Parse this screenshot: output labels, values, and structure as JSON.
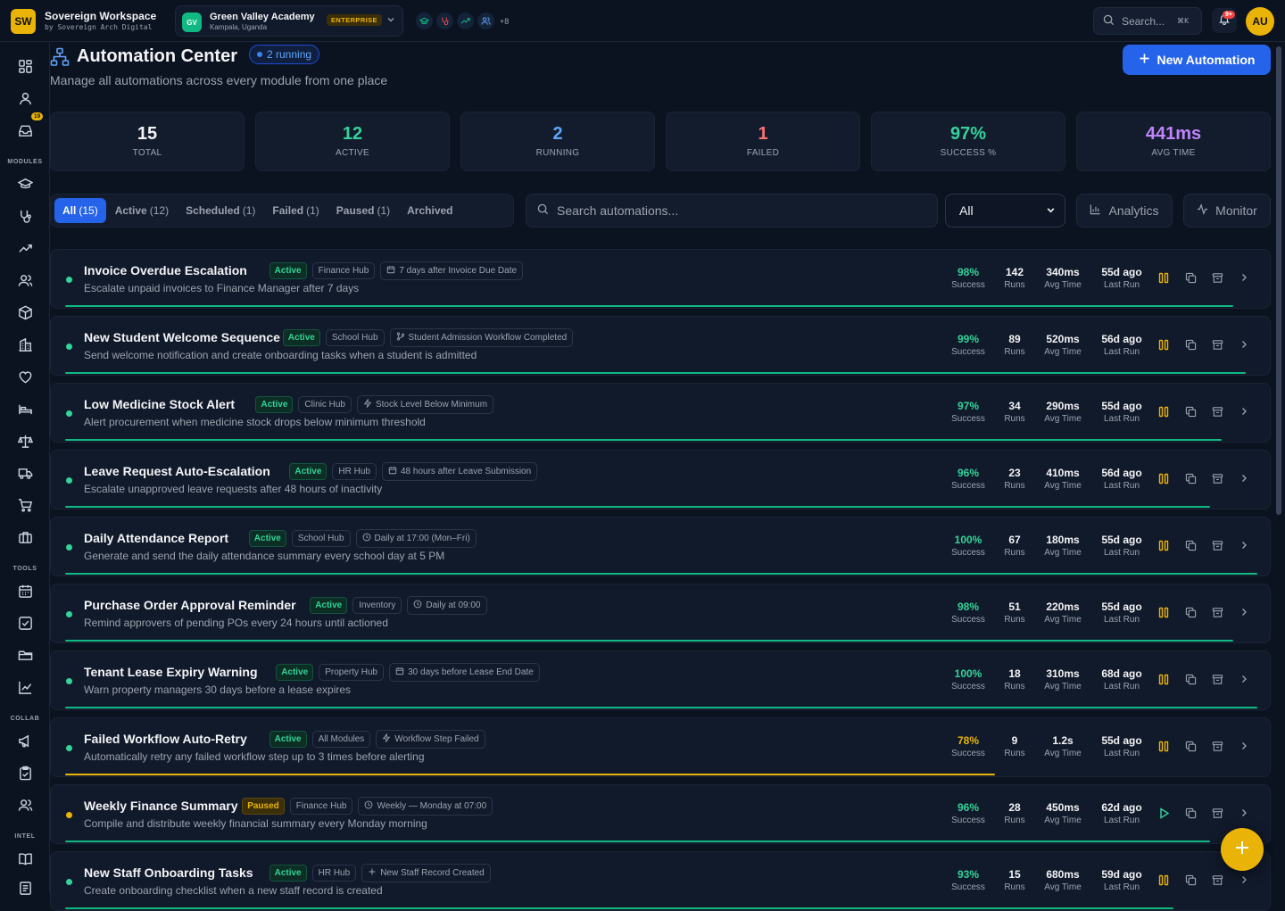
{
  "topbar": {
    "logo": "SW",
    "brand_title": "Sovereign Workspace",
    "brand_sub": "by Sovereign Arch Digital",
    "org_initials": "GV",
    "org_name": "Green Valley Academy",
    "org_location": "Kampala, Uganda",
    "org_badge": "ENTERPRISE",
    "modules_more": "+8",
    "search_label": "Search...",
    "search_kbd": "⌘K",
    "notif_count": "9+",
    "avatar": "AU"
  },
  "sidebar": {
    "badge": "19",
    "sections": [
      "MODULES",
      "TOOLS",
      "COLLAB",
      "INTEL"
    ]
  },
  "header": {
    "title": "Automation Center",
    "running": "2 running",
    "subtitle": "Manage all automations across every module from one place",
    "new_button": "New Automation"
  },
  "stats": [
    {
      "value": "15",
      "label": "TOTAL",
      "color": "#f3f4f6"
    },
    {
      "value": "12",
      "label": "ACTIVE",
      "color": "#34d399"
    },
    {
      "value": "2",
      "label": "RUNNING",
      "color": "#60a5fa"
    },
    {
      "value": "1",
      "label": "FAILED",
      "color": "#f87171"
    },
    {
      "value": "97%",
      "label": "SUCCESS %",
      "color": "#34d399"
    },
    {
      "value": "441ms",
      "label": "AVG TIME",
      "color": "#c084fc"
    }
  ],
  "tabs": [
    {
      "label": "All",
      "count": "(15)"
    },
    {
      "label": "Active",
      "count": "(12)"
    },
    {
      "label": "Scheduled",
      "count": "(1)"
    },
    {
      "label": "Failed",
      "count": "(1)"
    },
    {
      "label": "Paused",
      "count": "(1)"
    },
    {
      "label": "Archived",
      "count": ""
    }
  ],
  "toolbar": {
    "search_placeholder": "Search automations...",
    "filter_value": "All",
    "analytics": "Analytics",
    "monitor": "Monitor"
  },
  "metric_labels": {
    "success": "Success",
    "runs": "Runs",
    "avg": "Avg Time",
    "last": "Last Run"
  },
  "automations": [
    {
      "name": "Invoice Overdue Escalation",
      "status": "Active",
      "hub": "Finance Hub",
      "trigger": "7 days after Invoice Due Date",
      "trigger_icon": "calendar",
      "desc": "Escalate unpaid invoices to Finance Manager after 7 days",
      "success": "98%",
      "runs": "142",
      "avg": "340ms",
      "last": "55d ago",
      "progress": 0.98
    },
    {
      "name": "New Student Welcome Sequence",
      "status": "Active",
      "hub": "School Hub",
      "trigger": "Student Admission Workflow Completed",
      "trigger_icon": "branch",
      "desc": "Send welcome notification and create onboarding tasks when a student is admitted",
      "success": "99%",
      "runs": "89",
      "avg": "520ms",
      "last": "56d ago",
      "progress": 0.99
    },
    {
      "name": "Low Medicine Stock Alert",
      "status": "Active",
      "hub": "Clinic Hub",
      "trigger": "Stock Level Below Minimum",
      "trigger_icon": "bolt",
      "desc": "Alert procurement when medicine stock drops below minimum threshold",
      "success": "97%",
      "runs": "34",
      "avg": "290ms",
      "last": "55d ago",
      "progress": 0.97
    },
    {
      "name": "Leave Request Auto-Escalation",
      "status": "Active",
      "hub": "HR Hub",
      "trigger": "48 hours after Leave Submission",
      "trigger_icon": "calendar",
      "desc": "Escalate unapproved leave requests after 48 hours of inactivity",
      "success": "96%",
      "runs": "23",
      "avg": "410ms",
      "last": "56d ago",
      "progress": 0.96
    },
    {
      "name": "Daily Attendance Report",
      "status": "Active",
      "hub": "School Hub",
      "trigger": "Daily at 17:00 (Mon–Fri)",
      "trigger_icon": "clock",
      "desc": "Generate and send the daily attendance summary every school day at 5 PM",
      "success": "100%",
      "runs": "67",
      "avg": "180ms",
      "last": "55d ago",
      "progress": 1.0
    },
    {
      "name": "Purchase Order Approval Reminder",
      "status": "Active",
      "hub": "Inventory",
      "trigger": "Daily at 09:00",
      "trigger_icon": "clock",
      "desc": "Remind approvers of pending POs every 24 hours until actioned",
      "success": "98%",
      "runs": "51",
      "avg": "220ms",
      "last": "55d ago",
      "progress": 0.98
    },
    {
      "name": "Tenant Lease Expiry Warning",
      "status": "Active",
      "hub": "Property Hub",
      "trigger": "30 days before Lease End Date",
      "trigger_icon": "calendar",
      "desc": "Warn property managers 30 days before a lease expires",
      "success": "100%",
      "runs": "18",
      "avg": "310ms",
      "last": "68d ago",
      "progress": 1.0
    },
    {
      "name": "Failed Workflow Auto-Retry",
      "status": "Active",
      "hub": "All Modules",
      "trigger": "Workflow Step Failed",
      "trigger_icon": "bolt",
      "desc": "Automatically retry any failed workflow step up to 3 times before alerting",
      "success": "78%",
      "runs": "9",
      "avg": "1.2s",
      "last": "55d ago",
      "progress": 0.78
    },
    {
      "name": "Weekly Finance Summary",
      "status": "Paused",
      "hub": "Finance Hub",
      "trigger": "Weekly — Monday at 07:00",
      "trigger_icon": "clock",
      "desc": "Compile and distribute weekly financial summary every Monday morning",
      "success": "96%",
      "runs": "28",
      "avg": "450ms",
      "last": "62d ago",
      "progress": 0.96
    },
    {
      "name": "New Staff Onboarding Tasks",
      "status": "Active",
      "hub": "HR Hub",
      "trigger": "New Staff Record Created",
      "trigger_icon": "plus",
      "desc": "Create onboarding checklist when a new staff record is created",
      "success": "93%",
      "runs": "15",
      "avg": "680ms",
      "last": "59d ago",
      "progress": 0.93
    }
  ]
}
